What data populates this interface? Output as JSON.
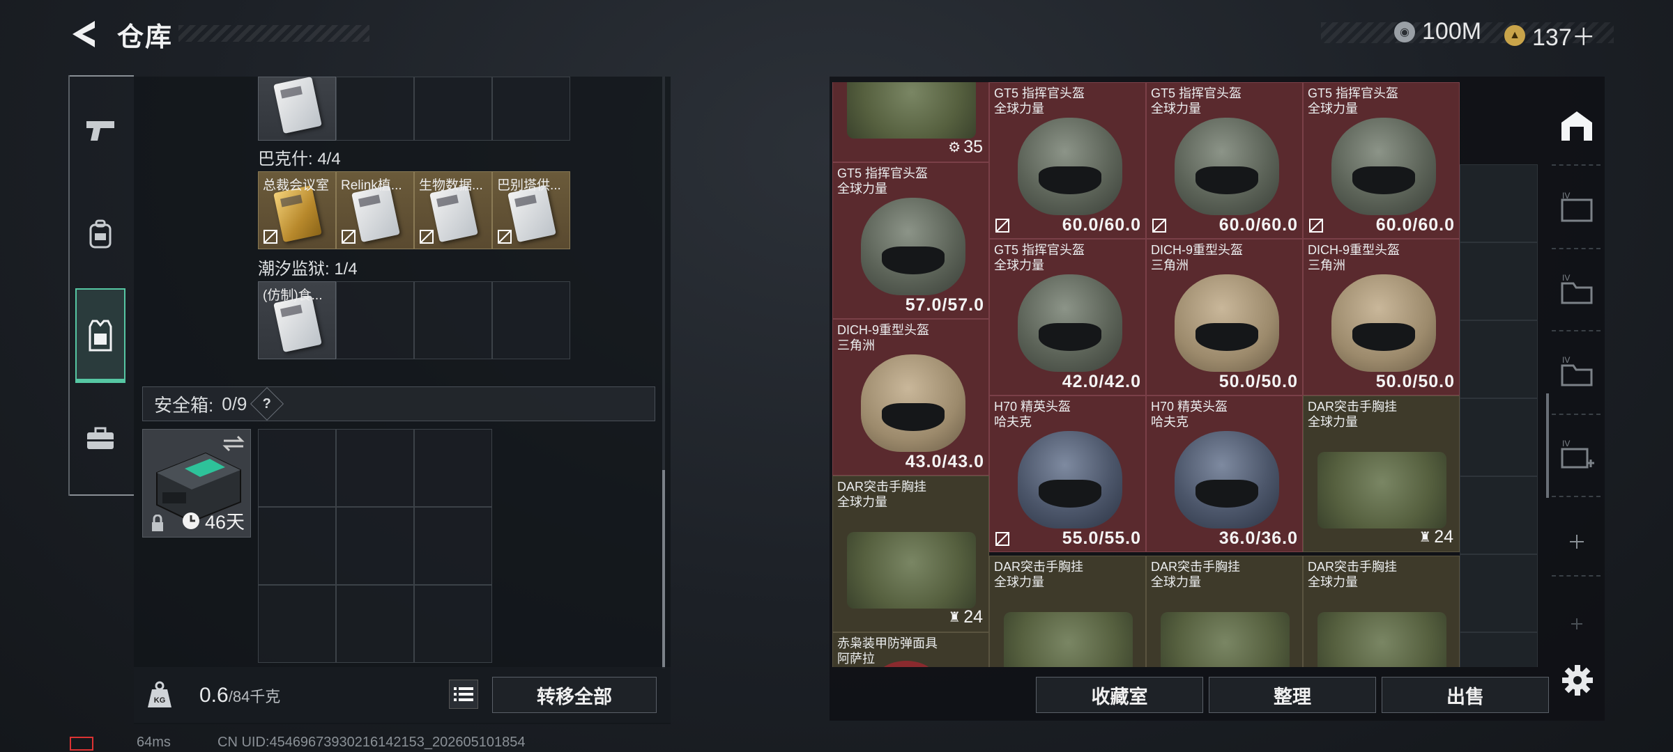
{
  "header": {
    "title": "仓库",
    "currencies": [
      {
        "icon": "coin-icon",
        "value": "100M"
      },
      {
        "icon": "gold-triangle-icon",
        "value": "137＋"
      }
    ]
  },
  "nav": {
    "items": [
      {
        "icon": "pistol-icon",
        "active": false
      },
      {
        "icon": "backpack-icon",
        "active": false
      },
      {
        "icon": "vest-icon",
        "active": true
      },
      {
        "icon": "briefcase-icon",
        "active": false
      }
    ]
  },
  "left_panel": {
    "sections": [
      {
        "label": "巴克什: 4/4"
      },
      {
        "label": "潮汐监狱: 1/4"
      }
    ],
    "barkesh_items": [
      "总裁会议室",
      "Relink植...",
      "生物数据...",
      "巴别塔供..."
    ],
    "tide_items": [
      "(仿制)食..."
    ],
    "safebox": {
      "label": "安全箱:",
      "count": "0/9",
      "help": "?",
      "days": "46天"
    },
    "weight": {
      "value": "0.6",
      "max": "/84千克"
    },
    "transfer_all": "转移全部"
  },
  "status": {
    "ping": "64ms",
    "uid": "CN UID:454696739302161421​53_202605101854"
  },
  "right_panel": {
    "items": [
      {
        "name": "",
        "brand": "",
        "kind": "vest",
        "count": "35"
      },
      {
        "name": "GT5 指挥官头盔",
        "brand": "全球力量",
        "kind": "gt5",
        "dur": "60.0/60.0"
      },
      {
        "name": "GT5 指挥官头盔",
        "brand": "全球力量",
        "kind": "gt5",
        "dur": "60.0/60.0"
      },
      {
        "name": "GT5 指挥官头盔",
        "brand": "全球力量",
        "kind": "gt5",
        "dur": "60.0/60.0"
      },
      {
        "name": "GT5 指挥官头盔",
        "brand": "全球力量",
        "kind": "gt5",
        "dur": "57.0/57.0"
      },
      {
        "name": "GT5 指挥官头盔",
        "brand": "全球力量",
        "kind": "gt5",
        "dur": "42.0/42.0"
      },
      {
        "name": "DICH-9重型头盔",
        "brand": "三角洲",
        "kind": "dich",
        "dur": "50.0/50.0"
      },
      {
        "name": "DICH-9重型头盔",
        "brand": "三角洲",
        "kind": "dich",
        "dur": "50.0/50.0"
      },
      {
        "name": "DICH-9重型头盔",
        "brand": "三角洲",
        "kind": "dich",
        "dur": "43.0/43.0"
      },
      {
        "name": "H70 精英头盔",
        "brand": "哈夫克",
        "kind": "h70",
        "dur": "55.0/55.0"
      },
      {
        "name": "H70 精英头盔",
        "brand": "哈夫克",
        "kind": "h70",
        "dur": "36.0/36.0"
      },
      {
        "name": "DAR突击手胸挂",
        "brand": "全球力量",
        "kind": "vest",
        "count": "24"
      },
      {
        "name": "DAR突击手胸挂",
        "brand": "全球力量",
        "kind": "vest",
        "count": "24"
      },
      {
        "name": "DAR突击手胸挂",
        "brand": "全球力量",
        "kind": "vest",
        "count": ""
      },
      {
        "name": "DAR突击手胸挂",
        "brand": "全球力量",
        "kind": "vest",
        "count": ""
      },
      {
        "name": "DAR突击手胸挂",
        "brand": "全球力量",
        "kind": "vest",
        "count": ""
      },
      {
        "name": "赤枭装甲防弹面具",
        "brand": "阿萨拉",
        "kind": "mask",
        "count": ""
      }
    ],
    "buttons": {
      "collection": "收藏室",
      "organize": "整理",
      "sell": "出售"
    }
  },
  "right_tabs": [
    {
      "icon": "stash-tab-icon",
      "active": true
    },
    {
      "icon": "tier-iv-safe-icon",
      "active": false
    },
    {
      "icon": "tier-iv-folder-icon",
      "active": false
    },
    {
      "icon": "tier-iv-folder-2-icon",
      "active": false
    },
    {
      "icon": "tier-iv-medkit-icon",
      "active": false
    },
    {
      "icon": "add-tab-icon",
      "active": false
    },
    {
      "icon": "add-tab-2-icon",
      "active": false
    }
  ]
}
